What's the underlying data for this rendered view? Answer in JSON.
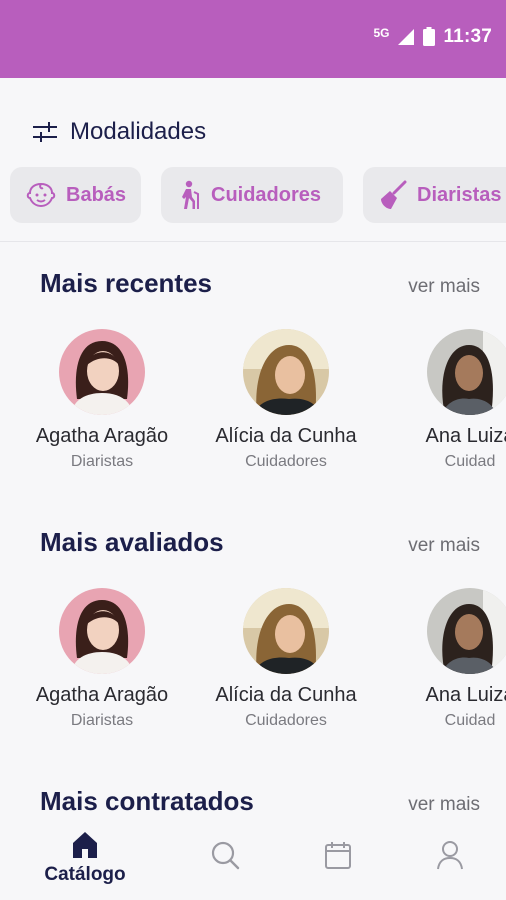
{
  "status_bar": {
    "network": "5G",
    "time": "11:37",
    "icons": [
      "signal-icon",
      "battery-icon"
    ]
  },
  "modalidades": {
    "title": "Modalidades",
    "icon": "sliders-icon"
  },
  "categories": [
    {
      "label": "Babás",
      "icon": "baby-icon"
    },
    {
      "label": "Cuidadores",
      "icon": "elderly-cane-icon"
    },
    {
      "label": "Diaristas",
      "icon": "broom-icon"
    }
  ],
  "sections": [
    {
      "title": "Mais recentes",
      "see_more": "ver mais",
      "profiles": [
        {
          "name": "Agatha Aragão",
          "category": "Diaristas"
        },
        {
          "name": "Alícia da Cunha",
          "category": "Cuidadores"
        },
        {
          "name": "Ana Luiza",
          "category": "Cuidad"
        }
      ]
    },
    {
      "title": "Mais avaliados",
      "see_more": "ver mais",
      "profiles": [
        {
          "name": "Agatha Aragão",
          "category": "Diaristas"
        },
        {
          "name": "Alícia da Cunha",
          "category": "Cuidadores"
        },
        {
          "name": "Ana Luiza",
          "category": "Cuidad"
        }
      ]
    },
    {
      "title": "Mais contratados",
      "see_more": "ver mais"
    }
  ],
  "bottom_nav": {
    "items": [
      {
        "label": "Catálogo",
        "icon": "home-icon",
        "active": true
      },
      {
        "label": "",
        "icon": "search-icon"
      },
      {
        "label": "",
        "icon": "calendar-icon"
      },
      {
        "label": "",
        "icon": "user-icon"
      }
    ]
  },
  "colors": {
    "brand": "#b85ebd",
    "heading": "#1c1f4a",
    "chip_bg": "#e9e9ec"
  }
}
